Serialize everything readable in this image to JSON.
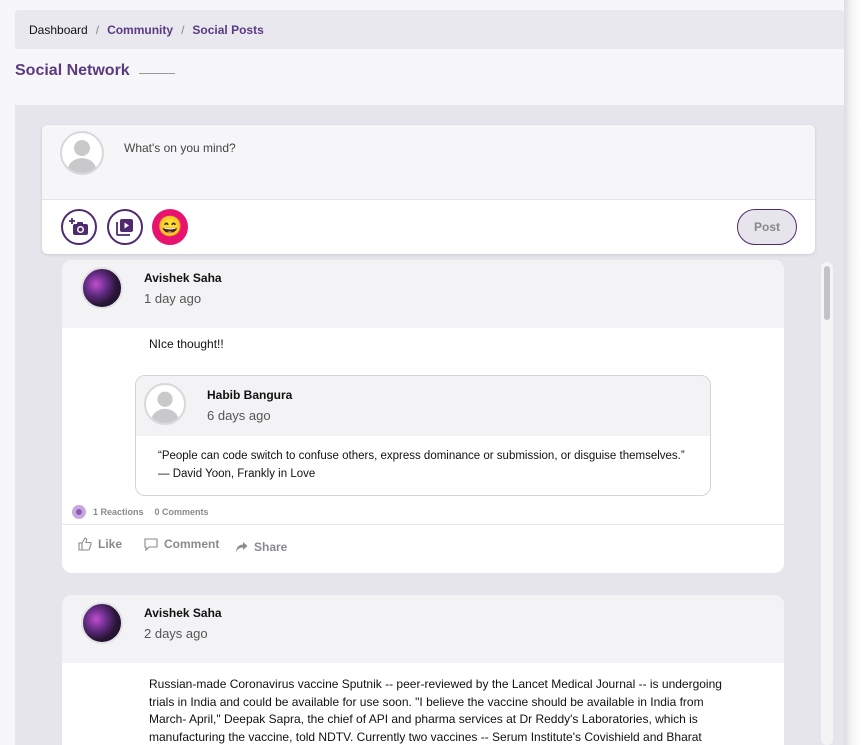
{
  "breadcrumb": {
    "home": "Dashboard",
    "separator": "/",
    "community": "Community",
    "current": "Social Posts"
  },
  "page": {
    "title": "Social Network"
  },
  "composer": {
    "placeholder": "What's on you mind?",
    "photo_icon": "camera-plus-icon",
    "video_icon": "video-library-icon",
    "emoji_icon": "smiley-emoji-icon",
    "emoji_glyph": "😄",
    "post_label": "Post"
  },
  "posts": [
    {
      "author": "Avishek Saha",
      "time": "1 day ago",
      "text": "NIce thought!!",
      "shared": {
        "author": "Habib Bangura",
        "time": "6 days ago",
        "line1": "“People can code switch to confuse others, express dominance or submission, or disguise themselves.”",
        "line2": "— David Yoon, Frankly in Love"
      },
      "reactions": "1 Reactions",
      "comments": "0 Comments",
      "actions": {
        "like": "Like",
        "comment": "Comment",
        "share": "Share"
      }
    },
    {
      "author": "Avishek Saha",
      "time": "2 days ago",
      "lines": [
        "Russian-made Coronavirus vaccine Sputnik -- peer-reviewed by the Lancet Medical Journal -- is undergoing",
        "trials in India and could be available for use soon. \"I believe the vaccine should be available in India from",
        "March- April,\" Deepak Sapra, the chief of API and pharma services at Dr Reddy's Laboratories, which is",
        "manufacturing the vaccine, told NDTV. Currently two vaccines -- Serum Institute's Covishield and Bharat"
      ]
    }
  ],
  "colors": {
    "brand_purple": "#5b3a82",
    "accent_pink": "#e8136e",
    "panel_bg": "#e6e5eb"
  }
}
